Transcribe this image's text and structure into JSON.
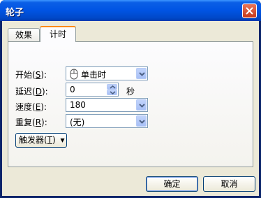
{
  "window": {
    "title": "轮子"
  },
  "tabs": [
    {
      "label": "效果"
    },
    {
      "label": "计时"
    }
  ],
  "timing": {
    "start": {
      "label_pre": "开始(",
      "key": "S",
      "label_post": "):",
      "value": "单击时"
    },
    "delay": {
      "label_pre": "延迟(",
      "key": "D",
      "label_post": "):",
      "value": "0",
      "unit": "秒"
    },
    "speed": {
      "label_pre": "速度(",
      "key": "E",
      "label_post": "):",
      "value": "180"
    },
    "repeat": {
      "label_pre": "重复(",
      "key": "R",
      "label_post": "):",
      "value": "(无)"
    },
    "trigger": {
      "label_pre": "触发器(",
      "key": "T",
      "label_post": ")",
      "arrow": "▾"
    }
  },
  "buttons": {
    "ok": "确定",
    "cancel": "取消"
  },
  "icons": {
    "close": "close-icon",
    "mouse": "mouse-icon"
  }
}
